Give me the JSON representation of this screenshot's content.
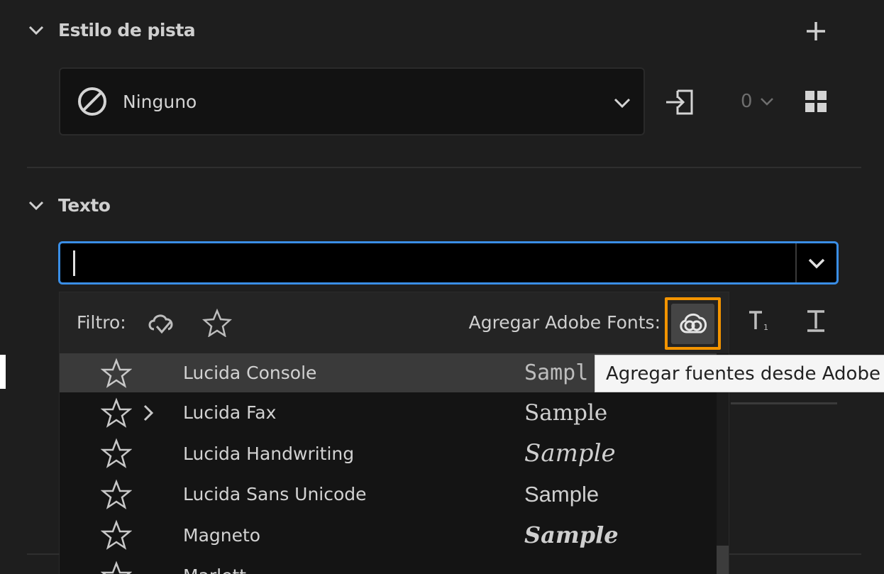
{
  "track_style": {
    "header": "Estilo de pista",
    "selected": "Ninguno",
    "count": "0"
  },
  "text_section": {
    "header": "Texto",
    "font_input_value": ""
  },
  "font_dropdown": {
    "filter_label": "Filtro:",
    "add_fonts_label": "Agregar Adobe Fonts:",
    "fonts": [
      {
        "name": "Lucida Console",
        "sample": "Sampl",
        "selected": true,
        "expandable": false
      },
      {
        "name": "Lucida Fax",
        "sample": "Sample",
        "selected": false,
        "expandable": true
      },
      {
        "name": "Lucida Handwriting",
        "sample": "Sample",
        "selected": false,
        "expandable": false
      },
      {
        "name": "Lucida Sans Unicode",
        "sample": "Sample",
        "selected": false,
        "expandable": false
      },
      {
        "name": "Magneto",
        "sample": "Sample",
        "selected": false,
        "expandable": false
      },
      {
        "name": "Marlett",
        "sample": "",
        "selected": false,
        "expandable": false
      }
    ]
  },
  "tooltip": "Agregar fuentes desde Adobe",
  "colors": {
    "accent_blue": "#3a8ee6",
    "highlight_orange": "#f39400",
    "background": "#1e1e1e"
  },
  "icons": [
    "chevron-down-icon",
    "plus-icon",
    "none-icon",
    "link-track-icon",
    "grid-icon",
    "sync-filter-icon",
    "star-icon",
    "creative-cloud-icon",
    "subscript-icon",
    "text-baseline-icon"
  ]
}
